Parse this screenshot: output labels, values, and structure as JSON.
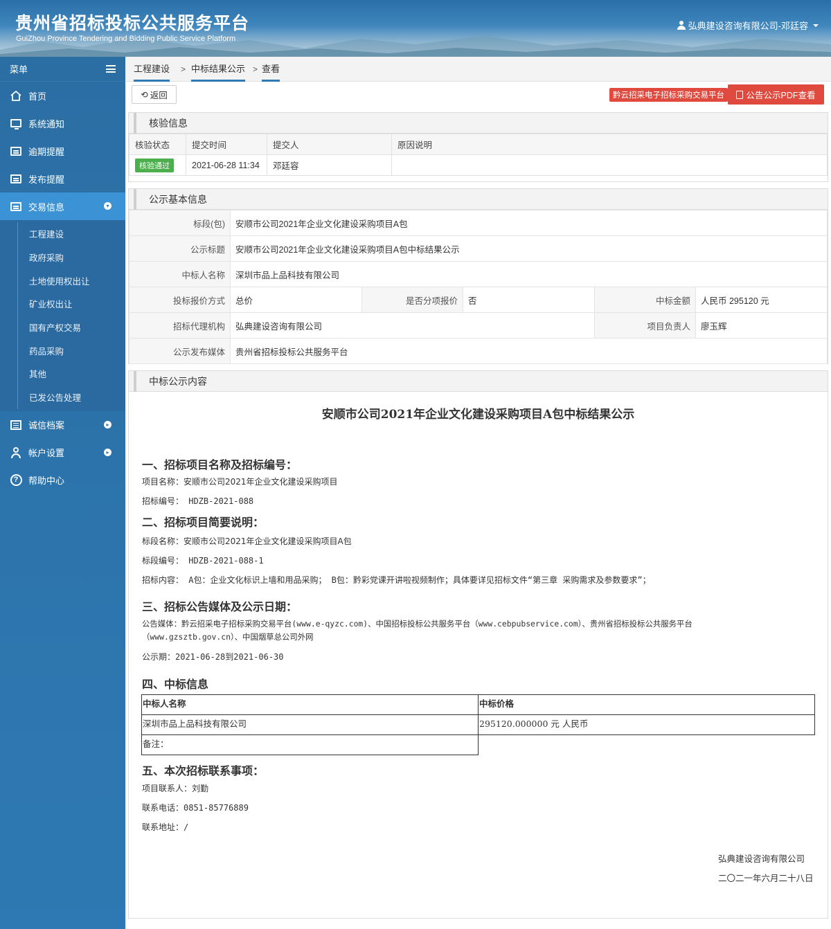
{
  "header": {
    "title": "贵州省招标投标公共服务平台",
    "subtitle": "GuiZhou Province Tendering and Bidding Public Service Platform",
    "user": "弘典建设咨询有限公司-邓廷容"
  },
  "sidebar": {
    "menu_label": "菜单",
    "items": [
      {
        "label": "首页"
      },
      {
        "label": "系统通知"
      },
      {
        "label": "逾期提醒"
      },
      {
        "label": "发布提醒"
      },
      {
        "label": "交易信息"
      },
      {
        "label": "诚信档案"
      },
      {
        "label": "帐户设置"
      },
      {
        "label": "帮助中心"
      }
    ],
    "subitems": [
      "工程建设",
      "政府采购",
      "土地使用权出让",
      "矿业权出让",
      "国有产权交易",
      "药品采购",
      "其他",
      "已发公告处理"
    ]
  },
  "breadcrumb": [
    "工程建设",
    "中标结果公示",
    "查看"
  ],
  "toolbar": {
    "back": "返回",
    "platform_link": "黔云招采电子招标采购交易平台",
    "pdf": "公告公示PDF查看"
  },
  "verify": {
    "title": "核验信息",
    "headers": [
      "核验状态",
      "提交时间",
      "提交人",
      "原因说明"
    ],
    "status": "核验通过",
    "time": "2021-06-28 11:34",
    "submitter": "邓廷容",
    "reason": ""
  },
  "basic": {
    "title": "公示基本信息",
    "section_label": "标段(包)",
    "section_value": "安顺市公司2021年企业文化建设采购项目A包",
    "notice_title_label": "公示标题",
    "notice_title_value": "安顺市公司2021年企业文化建设采购项目A包中标结果公示",
    "winner_label": "中标人名称",
    "winner_value": "深圳市品上品科技有限公司",
    "quote_method_label": "投标报价方式",
    "quote_method_value": "总价",
    "split_quote_label": "是否分项报价",
    "split_quote_value": "否",
    "amount_label": "中标金额",
    "amount_value": "人民币 295120 元",
    "agency_label": "招标代理机构",
    "agency_value": "弘典建设咨询有限公司",
    "manager_label": "项目负责人",
    "manager_value": "廖玉辉",
    "media_label": "公示发布媒体",
    "media_value": "贵州省招标投标公共服务平台"
  },
  "content": {
    "panel_title": "中标公示内容",
    "doc_title": "安顺市公司2021年企业文化建设采购项目A包中标结果公示",
    "s1": "一、招标项目名称及招标编号：",
    "s1_p1": "项目名称：安顺市公司2021年企业文化建设采购项目",
    "s1_p2": "招标编号： HDZB-2021-088",
    "s2": "二、招标项目简要说明：",
    "s2_p1": "标段名称：安顺市公司2021年企业文化建设采购项目A包",
    "s2_p2": "标段编号： HDZB-2021-088-1",
    "s2_p3": "招标内容： A包：企业文化标识上墙和用品采购； B包：黔彩党课开讲啦视频制作；具体要详见招标文件“第三章 采购需求及参数要求”；",
    "s3": "三、招标公告媒体及公示日期：",
    "s3_p1": "公告媒体：黔云招采电子招标采购交易平台(www.e-qyzc.com)、中国招标投标公共服务平台（www.cebpubservice.com）、贵州省招标投标公共服务平台",
    "s3_p1b": "（www.gzsztb.gov.cn）、中国烟草总公司外网",
    "s3_p2": "公示期：2021-06-28到2021-06-30",
    "s4": "四、中标信息",
    "award_h1": "中标人名称",
    "award_h2": "中标价格",
    "award_name": "深圳市品上品科技有限公司",
    "award_price": "295120.000000 元 人民币",
    "award_note": "备注：",
    "s5": "五、本次招标联系事项：",
    "s5_p1": "项目联系人：刘勤",
    "s5_p2": "联系电话：0851-85776889",
    "s5_p3": "联系地址：/",
    "sign_org": "弘典建设咨询有限公司",
    "sign_date": "二〇二一年六月二十八日"
  }
}
